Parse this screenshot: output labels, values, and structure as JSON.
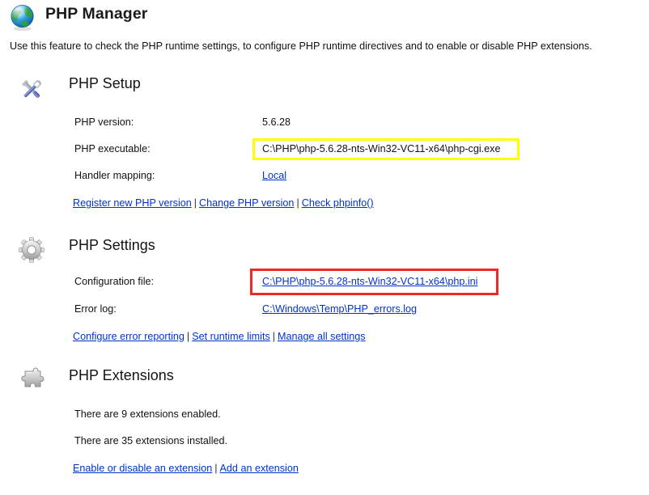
{
  "header": {
    "icon": "globe-icon",
    "title": "PHP Manager",
    "description": "Use this feature to check the PHP runtime settings, to configure PHP runtime directives and to enable or disable PHP extensions."
  },
  "sections": [
    {
      "id": "php-setup",
      "icon": "wrench-screwdriver-icon",
      "title": "PHP Setup",
      "fields": [
        {
          "label": "PHP version:",
          "value": "5.6.28",
          "type": "text"
        },
        {
          "label": "PHP executable:",
          "value": "C:\\PHP\\php-5.6.28-nts-Win32-VC11-x64\\php-cgi.exe",
          "type": "text",
          "highlight": "yellow"
        },
        {
          "label": "Handler mapping:",
          "value": "Local",
          "type": "link"
        }
      ],
      "links": [
        "Register new PHP version",
        "Change PHP version",
        "Check phpinfo()"
      ]
    },
    {
      "id": "php-settings",
      "icon": "gear-icon",
      "title": "PHP Settings",
      "fields": [
        {
          "label": "Configuration file:",
          "value": "C:\\PHP\\php-5.6.28-nts-Win32-VC11-x64\\php.ini",
          "type": "link",
          "highlight": "red"
        },
        {
          "label": "Error log:",
          "value": "C:\\Windows\\Temp\\PHP_errors.log",
          "type": "link"
        }
      ],
      "links": [
        "Configure error reporting",
        "Set runtime limits",
        "Manage all settings"
      ]
    },
    {
      "id": "php-extensions",
      "icon": "puzzle-piece-icon",
      "title": "PHP Extensions",
      "lines": [
        "There are 9 extensions enabled.",
        "There are 35 extensions installed."
      ],
      "links": [
        "Enable or disable an extension",
        "Add an extension"
      ]
    }
  ],
  "separator": "|",
  "colors": {
    "link": "#0033cc",
    "heading": "#141414",
    "highlight_yellow": "#ffff00",
    "highlight_red": "#ee2a24",
    "background": "#ffffff"
  }
}
